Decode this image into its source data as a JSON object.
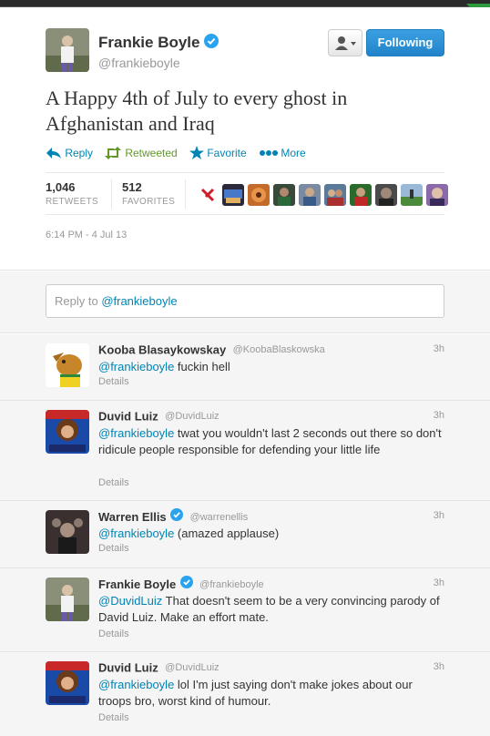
{
  "main": {
    "name": "Frankie Boyle",
    "handle": "@frankieboyle",
    "text": "A Happy 4th of July to every ghost in Afghanistan and Iraq",
    "follow_label": "Following",
    "actions": {
      "reply": "Reply",
      "retweeted": "Retweeted",
      "favorite": "Favorite",
      "more": "More"
    },
    "stats": {
      "retweets_count": "1,046",
      "retweets_label": "RETWEETS",
      "favorites_count": "512",
      "favorites_label": "FAVORITES"
    },
    "timestamp": "6:14 PM - 4 Jul 13"
  },
  "reply_box": {
    "prefix": "Reply to ",
    "mention": "@frankieboyle"
  },
  "replies": [
    {
      "name": "Kooba Blasaykowskay",
      "handle": "@KoobaBlaskowska",
      "time": "3h",
      "mention": "@frankieboyle",
      "text": " fuckin hell",
      "details": "Details",
      "verified": false
    },
    {
      "name": "Duvid Luiz",
      "handle": "@DuvidLuiz",
      "time": "3h",
      "mention": "@frankieboyle",
      "text": " twat you wouldn't last 2 seconds out there so don't ridicule people responsible for defending your little life",
      "details": "Details",
      "verified": false
    },
    {
      "name": "Warren Ellis",
      "handle": "@warrenellis",
      "time": "3h",
      "mention": "@frankieboyle",
      "text": " (amazed applause)",
      "details": "Details",
      "verified": true
    },
    {
      "name": "Frankie Boyle",
      "handle": "@frankieboyle",
      "time": "3h",
      "mention": "@DuvidLuiz",
      "text": " That doesn't seem to be a very convincing parody of David Luiz. Make an effort mate.",
      "details": "Details",
      "verified": true
    },
    {
      "name": "Duvid Luiz",
      "handle": "@DuvidLuiz",
      "time": "3h",
      "mention": "@frankieboyle",
      "text": " lol I'm just saying don't make jokes about our troops bro, worst kind of humour.",
      "details": "Details",
      "verified": false
    }
  ],
  "colors": {
    "link": "#0084b4",
    "retweeted": "#609928",
    "follow_button": "#2b90d9",
    "verified": "#2aa3ef"
  },
  "icons": [
    "reply-icon",
    "retweet-icon",
    "star-icon",
    "more-dots-icon",
    "verified-badge-icon",
    "user-dropdown-icon",
    "corner-fold-icon"
  ]
}
